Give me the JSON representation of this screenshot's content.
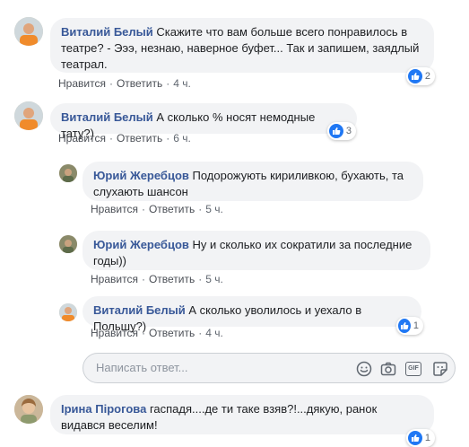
{
  "comments": [
    {
      "author": "Виталий Белый",
      "text": "Скажите что вам больше всего понравилось в театре? - Эээ, незнаю, наверное буфет... Так и запишем, заядлый театрал.",
      "like": "Нравится",
      "reply": "Ответить",
      "time": "4 ч.",
      "reaction_count": "2"
    },
    {
      "author": "Виталий Белый",
      "text": "А сколько % носят немодные тату?)",
      "like": "Нравится",
      "reply": "Ответить",
      "time": "6 ч.",
      "reaction_count": "3"
    }
  ],
  "replies": [
    {
      "author": "Юрий Жеребцов",
      "text": "Подорожують кириливкою, бухають, та слухають шансон",
      "like": "Нравится",
      "reply": "Ответить",
      "time": "5 ч."
    },
    {
      "author": "Юрий Жеребцов",
      "text": "Ну и сколько их сократили за последние годы))",
      "like": "Нравится",
      "reply": "Ответить",
      "time": "5 ч."
    },
    {
      "author": "Виталий Белый",
      "text": "А сколько уволилось и уехало в Польшу?)",
      "like": "Нравится",
      "reply": "Ответить",
      "time": "4 ч.",
      "reaction_count": "1"
    }
  ],
  "composer": {
    "placeholder": "Написать ответ...",
    "icons": [
      "emoji-icon",
      "camera-icon",
      "gif-icon",
      "sticker-icon"
    ]
  },
  "last_comment": {
    "author": "Ірина Пірогова",
    "text": "гаспадя....де ти таке взяв?!...дякую, ранок видався веселим!",
    "reaction_count": "1"
  },
  "colors": {
    "author": "#385898",
    "bubble": "#f2f3f5",
    "like_blue": "#2078f4",
    "meta": "#606770"
  }
}
